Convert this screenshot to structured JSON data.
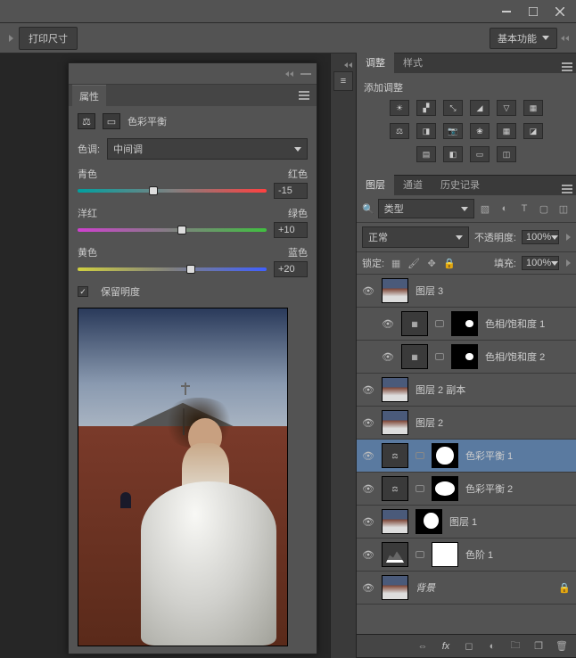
{
  "toolbar": {
    "print_size": "打印尺寸",
    "workspace": "基本功能"
  },
  "properties": {
    "tab": "属性",
    "title": "色彩平衡",
    "tone_label": "色调:",
    "tone_value": "中间调",
    "sliders": [
      {
        "left": "青色",
        "right": "红色",
        "value": "-15",
        "pos": 40
      },
      {
        "left": "洋红",
        "right": "绿色",
        "value": "+10",
        "pos": 55
      },
      {
        "left": "黄色",
        "right": "蓝色",
        "value": "+20",
        "pos": 60
      }
    ],
    "preserve": "保留明度"
  },
  "adjustments": {
    "tab1": "调整",
    "tab2": "样式",
    "add_label": "添加调整"
  },
  "layers_panel": {
    "tabs": [
      "图层",
      "通道",
      "历史记录"
    ],
    "kind_label": "类型",
    "blend": "正常",
    "opacity_label": "不透明度:",
    "opacity": "100%",
    "lock_label": "锁定:",
    "fill_label": "填充:",
    "fill": "100%"
  },
  "layers": [
    {
      "name": "图层 3",
      "type": "img"
    },
    {
      "name": "色相/饱和度 1",
      "type": "adj-hue",
      "mask": "dark",
      "indent": true
    },
    {
      "name": "色相/饱和度 2",
      "type": "adj-hue",
      "mask": "dark",
      "indent": true
    },
    {
      "name": "图层 2 副本",
      "type": "img"
    },
    {
      "name": "图层 2",
      "type": "img"
    },
    {
      "name": "色彩平衡 1",
      "type": "adj-cb",
      "mask": "blob1",
      "selected": true
    },
    {
      "name": "色彩平衡 2",
      "type": "adj-cb",
      "mask": "blob2"
    },
    {
      "name": "图层 1",
      "type": "img-mask"
    },
    {
      "name": "色阶 1",
      "type": "adj-levels",
      "mask": "white"
    },
    {
      "name": "背景",
      "type": "img",
      "locked": true,
      "italic": true
    }
  ]
}
